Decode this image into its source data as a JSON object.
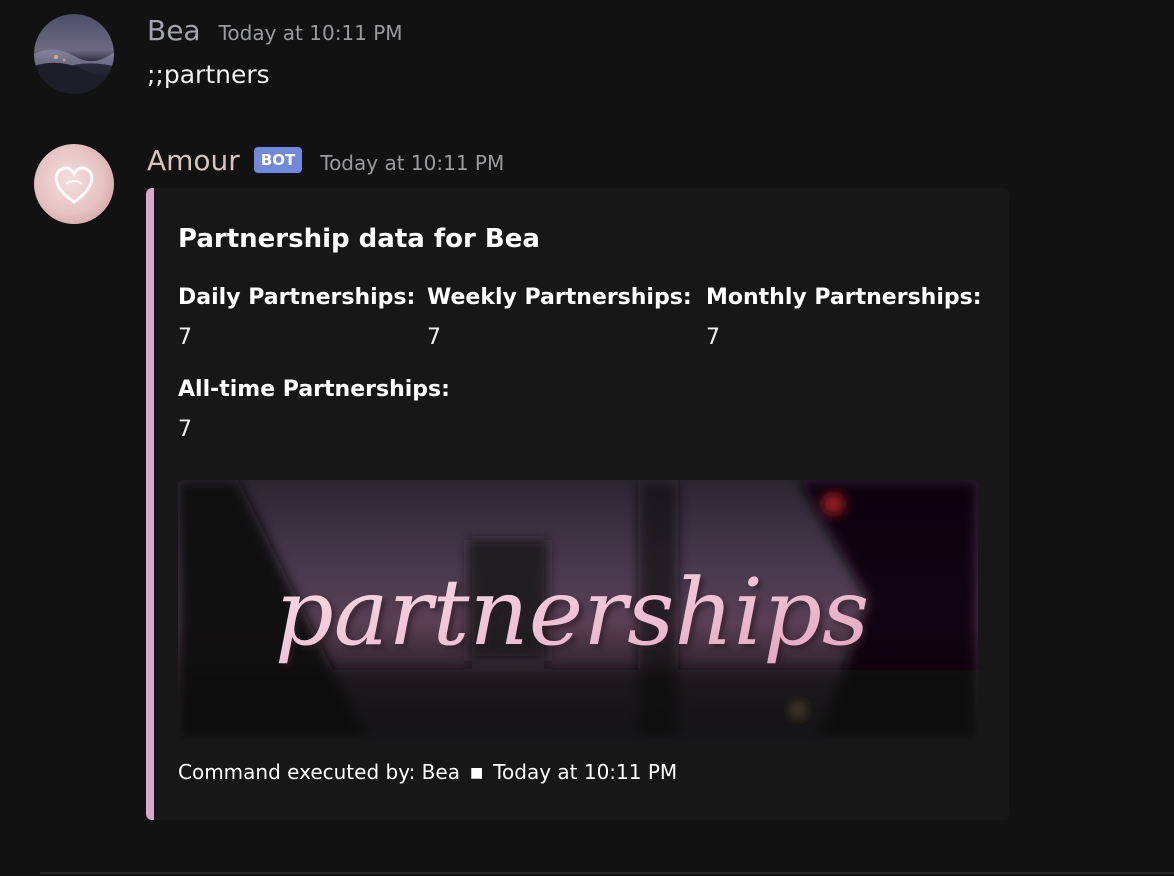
{
  "messages": [
    {
      "author": "Bea",
      "author_color": "#a3a3b2",
      "timestamp": "Today at 10:11 PM",
      "content": ";;partners"
    },
    {
      "author": "Amour",
      "author_color": "#d7c2bf",
      "bot_tag": "BOT",
      "timestamp": "Today at 10:11 PM",
      "embed": {
        "accent_color": "#d9a9cb",
        "title": "Partnership data for Bea",
        "fields": [
          {
            "name": "Daily Partnerships:",
            "value": "7"
          },
          {
            "name": "Weekly Partnerships:",
            "value": "7"
          },
          {
            "name": "Monthly Partnerships:",
            "value": "7"
          },
          {
            "name": "All-time Partnerships:",
            "value": "7"
          }
        ],
        "image_text": "partnerships",
        "footer": {
          "text": "Command executed by: Bea",
          "separator": "■",
          "timestamp": "Today at 10:11 PM"
        }
      }
    }
  ]
}
